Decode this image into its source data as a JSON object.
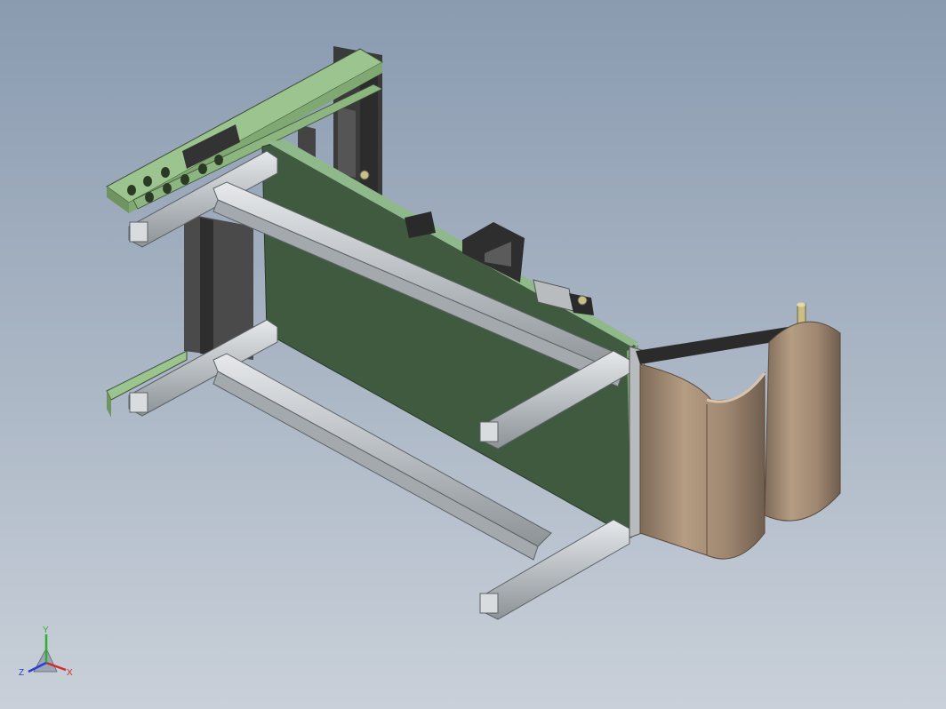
{
  "viewport": {
    "background_top": "#8a9bb0",
    "background_bottom": "#c9d0d9"
  },
  "model": {
    "panel_color": "#3f5a3f",
    "panel_edge_color": "#8fb98a",
    "bracket_color": "#9cc48e",
    "extrusion_color": "#c8cccf",
    "frame_dark_color": "#3c3c3c",
    "cylinder_color": "#b29a80",
    "arm_color": "#2b2b2b",
    "pin_color": "#c9be86"
  },
  "triad": {
    "x_label": "X",
    "y_label": "Y",
    "z_label": "Z",
    "x_color": "#d22a2a",
    "y_color": "#2fae2f",
    "z_color": "#2a3fd2"
  }
}
